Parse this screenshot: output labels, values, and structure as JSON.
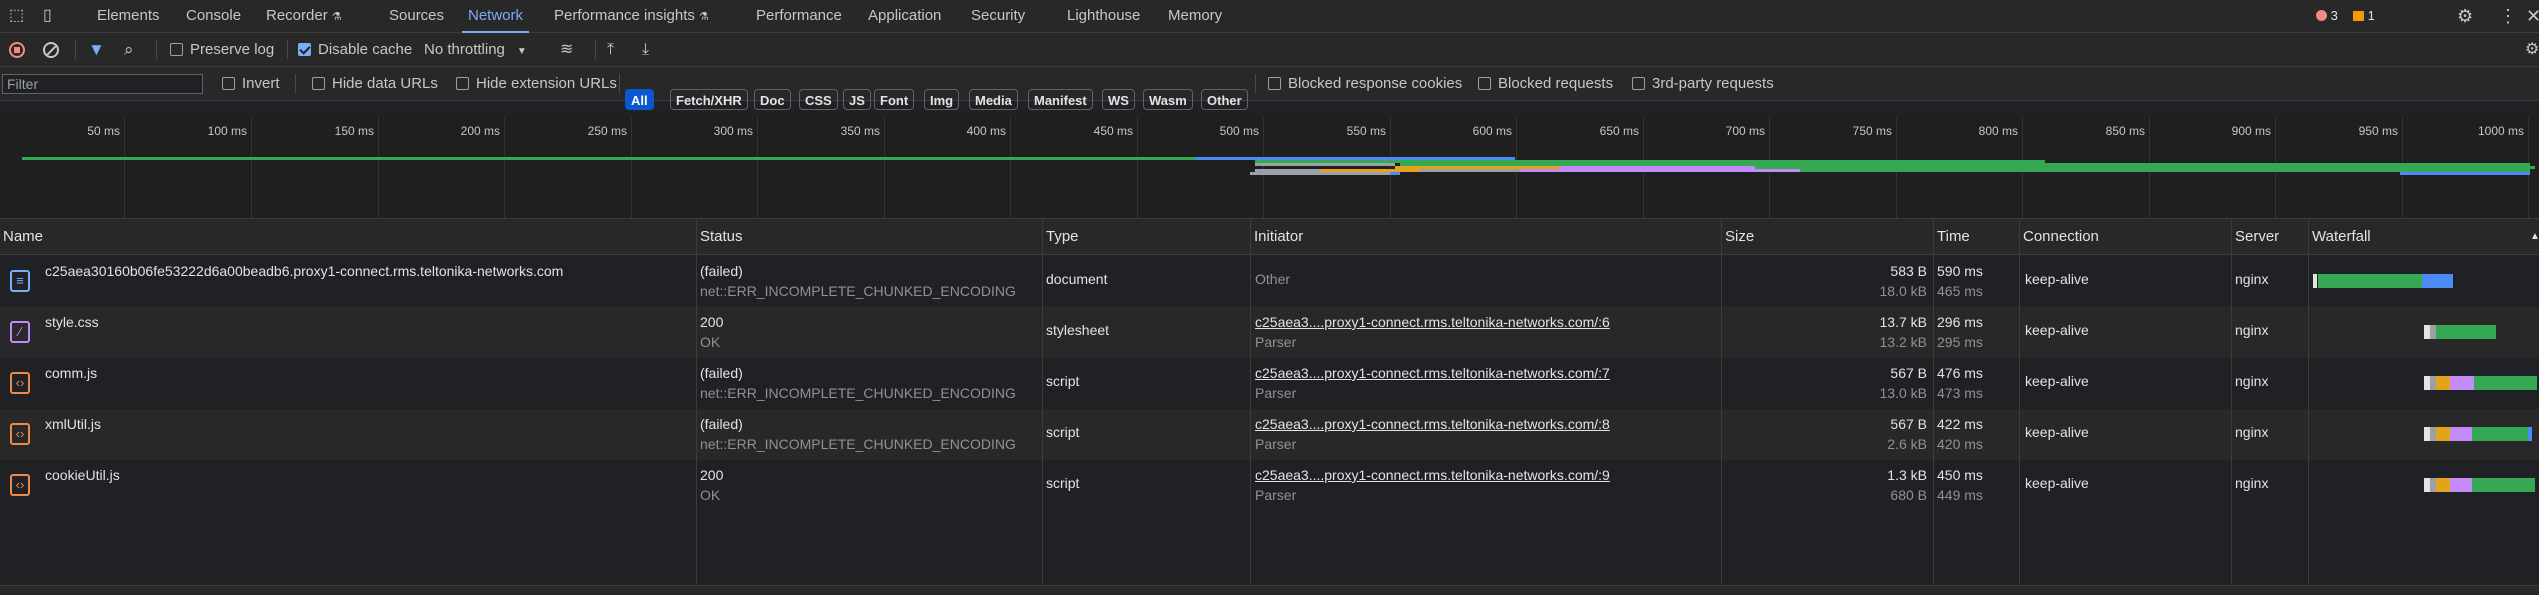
{
  "tabs": [
    {
      "label": "Elements"
    },
    {
      "label": "Console"
    },
    {
      "label": "Recorder"
    },
    {
      "label": "Sources"
    },
    {
      "label": "Network"
    },
    {
      "label": "Performance insights"
    },
    {
      "label": "Performance"
    },
    {
      "label": "Application"
    },
    {
      "label": "Security"
    },
    {
      "label": "Lighthouse"
    },
    {
      "label": "Memory"
    }
  ],
  "status": {
    "errors": "3",
    "warnings": "1"
  },
  "toolbar": {
    "preserve_log": "Preserve log",
    "disable_cache": "Disable cache",
    "throttling": "No throttling"
  },
  "filterbar": {
    "placeholder": "Filter",
    "invert": "Invert",
    "hide_data_urls": "Hide data URLs",
    "hide_extension_urls": "Hide extension URLs",
    "types": [
      "All",
      "Fetch/XHR",
      "Doc",
      "CSS",
      "JS",
      "Font",
      "Img",
      "Media",
      "Manifest",
      "WS",
      "Wasm",
      "Other"
    ],
    "blocked_cookies": "Blocked response cookies",
    "blocked_requests": "Blocked requests",
    "third_party": "3rd-party requests"
  },
  "overview": {
    "ticks": [
      "50 ms",
      "100 ms",
      "150 ms",
      "200 ms",
      "250 ms",
      "300 ms",
      "350 ms",
      "400 ms",
      "450 ms",
      "500 ms",
      "550 ms",
      "600 ms",
      "650 ms",
      "700 ms",
      "750 ms",
      "800 ms",
      "850 ms",
      "900 ms",
      "950 ms",
      "1000 ms"
    ]
  },
  "table": {
    "columns": [
      "Name",
      "Status",
      "Type",
      "Initiator",
      "Size",
      "Time",
      "Connection",
      "Server",
      "Waterfall"
    ],
    "rows": [
      {
        "name": "c25aea30160b06fe53222d6a00beadb6.proxy1-connect.rms.teltonika-networks.com",
        "status": "(failed)",
        "status_sub": "net::ERR_INCOMPLETE_CHUNKED_ENCODING",
        "type": "document",
        "initiator": "Other",
        "initiator_sub": "",
        "size": "583 B",
        "size_sub": "18.0 kB",
        "time": "590 ms",
        "time_sub": "465 ms",
        "connection": "keep-alive",
        "server": "nginx",
        "icon": "document-icon",
        "icon_color": "#7cacf8"
      },
      {
        "name": "style.css",
        "status": "200",
        "status_sub": "OK",
        "type": "stylesheet",
        "initiator": "c25aea3....proxy1-connect.rms.teltonika-networks.com/:6",
        "initiator_sub": "Parser",
        "size": "13.7 kB",
        "size_sub": "13.2 kB",
        "time": "296 ms",
        "time_sub": "295 ms",
        "connection": "keep-alive",
        "server": "nginx",
        "icon": "stylesheet-icon",
        "icon_color": "#c58af9"
      },
      {
        "name": "comm.js",
        "status": "(failed)",
        "status_sub": "net::ERR_INCOMPLETE_CHUNKED_ENCODING",
        "type": "script",
        "initiator": "c25aea3....proxy1-connect.rms.teltonika-networks.com/:7",
        "initiator_sub": "Parser",
        "size": "567 B",
        "size_sub": "13.0 kB",
        "time": "476 ms",
        "time_sub": "473 ms",
        "connection": "keep-alive",
        "server": "nginx",
        "icon": "script-icon",
        "icon_color": "#ee8a4a"
      },
      {
        "name": "xmlUtil.js",
        "status": "(failed)",
        "status_sub": "net::ERR_INCOMPLETE_CHUNKED_ENCODING",
        "type": "script",
        "initiator": "c25aea3....proxy1-connect.rms.teltonika-networks.com/:8",
        "initiator_sub": "Parser",
        "size": "567 B",
        "size_sub": "2.6 kB",
        "time": "422 ms",
        "time_sub": "420 ms",
        "connection": "keep-alive",
        "server": "nginx",
        "icon": "script-icon",
        "icon_color": "#ee8a4a"
      },
      {
        "name": "cookieUtil.js",
        "status": "200",
        "status_sub": "OK",
        "type": "script",
        "initiator": "c25aea3....proxy1-connect.rms.teltonika-networks.com/:9",
        "initiator_sub": "Parser",
        "size": "1.3 kB",
        "size_sub": "680 B",
        "time": "450 ms",
        "time_sub": "449 ms",
        "connection": "keep-alive",
        "server": "nginx",
        "icon": "script-icon",
        "icon_color": "#ee8a4a"
      }
    ]
  }
}
